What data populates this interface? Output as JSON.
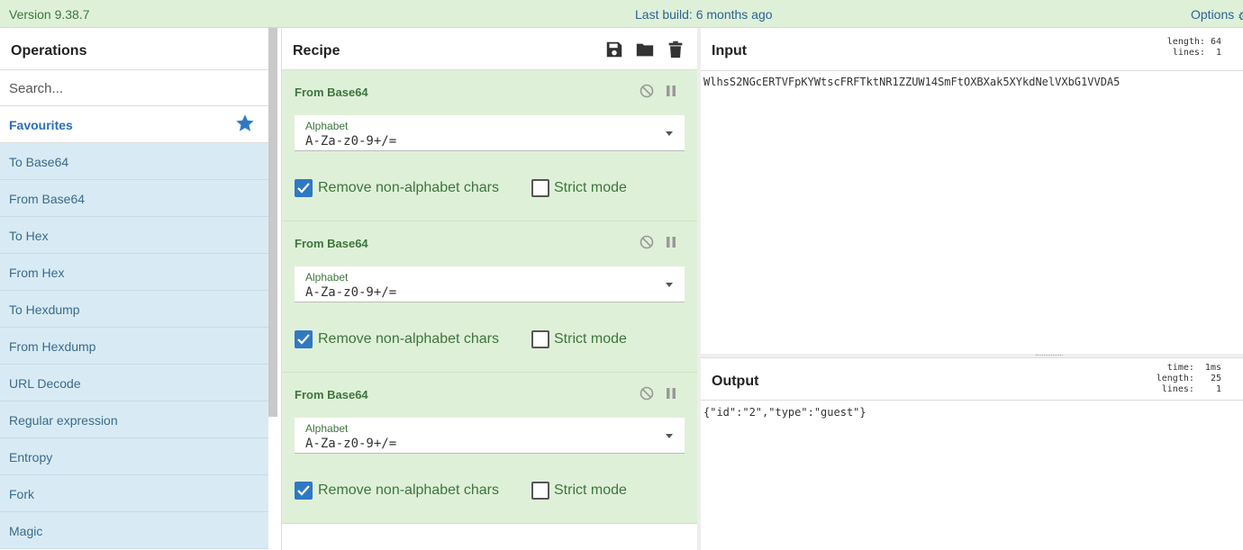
{
  "topbar": {
    "version": "Version 9.38.7",
    "last_build": "Last build: 6 months ago",
    "options": "Options"
  },
  "operations": {
    "title": "Operations",
    "search_placeholder": "Search...",
    "favourites": "Favourites",
    "items": [
      "To Base64",
      "From Base64",
      "To Hex",
      "From Hex",
      "To Hexdump",
      "From Hexdump",
      "URL Decode",
      "Regular expression",
      "Entropy",
      "Fork",
      "Magic"
    ]
  },
  "recipe": {
    "title": "Recipe",
    "ops": [
      {
        "name": "From Base64",
        "alphabet_label": "Alphabet",
        "alphabet_value": "A-Za-z0-9+/=",
        "remove_label": "Remove non-alphabet chars",
        "remove_checked": true,
        "strict_label": "Strict mode",
        "strict_checked": false
      },
      {
        "name": "From Base64",
        "alphabet_label": "Alphabet",
        "alphabet_value": "A-Za-z0-9+/=",
        "remove_label": "Remove non-alphabet chars",
        "remove_checked": true,
        "strict_label": "Strict mode",
        "strict_checked": false
      },
      {
        "name": "From Base64",
        "alphabet_label": "Alphabet",
        "alphabet_value": "A-Za-z0-9+/=",
        "remove_label": "Remove non-alphabet chars",
        "remove_checked": true,
        "strict_label": "Strict mode",
        "strict_checked": false
      }
    ]
  },
  "input": {
    "title": "Input",
    "stats": "length: 64\nlines:  1",
    "text": "WlhsS2NGcERTVFpKYWtscFRFTktNR1ZZUW14SmFtOXBXak5XYkdNelVXbG1VVDA5"
  },
  "output": {
    "title": "Output",
    "stats": "time:  1ms\nlength:   25\nlines:    1",
    "text": "{\"id\":\"2\",\"type\":\"guest\"}"
  },
  "colors": {
    "accent": "#2f79c2",
    "recipe_bg": "#dff0d8",
    "ops_bg": "#d8ebf5",
    "topbar_bg": "#dff0d8"
  }
}
